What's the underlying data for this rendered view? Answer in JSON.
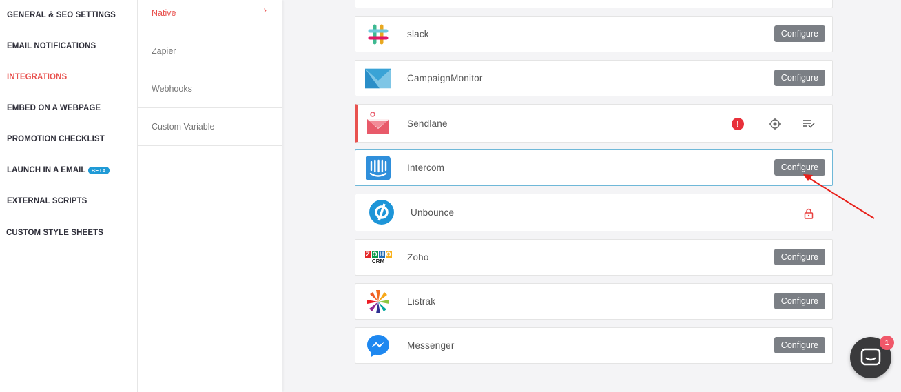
{
  "sidebar": {
    "items": [
      {
        "label": "GENERAL & SEO SETTINGS"
      },
      {
        "label": "EMAIL NOTIFICATIONS"
      },
      {
        "label": "INTEGRATIONS",
        "active": true
      },
      {
        "label": "EMBED ON A WEBPAGE"
      },
      {
        "label": "PROMOTION CHECKLIST"
      },
      {
        "label": "LAUNCH IN A EMAIL",
        "badge": "BETA"
      },
      {
        "label": "EXTERNAL SCRIPTS"
      },
      {
        "label": "CUSTOM STYLE SHEETS"
      }
    ]
  },
  "subnav": {
    "items": [
      {
        "label": "Native",
        "active": true,
        "icon": "chevron-right-icon"
      },
      {
        "label": "Zapier"
      },
      {
        "label": "Webhooks"
      },
      {
        "label": "Custom Variable"
      }
    ]
  },
  "integrations": [
    {
      "name": "slack",
      "button": "Configure"
    },
    {
      "name": "CampaignMonitor",
      "button": "Configure"
    },
    {
      "name": "Sendlane",
      "status": "error",
      "icons": [
        "alert-icon",
        "target-icon",
        "list-check-icon"
      ]
    },
    {
      "name": "Intercom",
      "button": "Configure",
      "highlighted": true
    },
    {
      "name": "Unbounce",
      "status": "locked",
      "icons": [
        "lock-icon"
      ]
    },
    {
      "name": "Zoho",
      "button": "Configure",
      "logo_text": [
        "Z",
        "O",
        "H",
        "O",
        "CRM"
      ]
    },
    {
      "name": "Listrak",
      "button": "Configure"
    },
    {
      "name": "Messenger",
      "button": "Configure"
    }
  ],
  "chat_widget": {
    "badge_count": "1"
  },
  "colors": {
    "accent": "#e8524f",
    "configure_button": "#7b7f85",
    "beta_badge": "#1f9ad6",
    "annotation_arrow": "#e8201a"
  }
}
